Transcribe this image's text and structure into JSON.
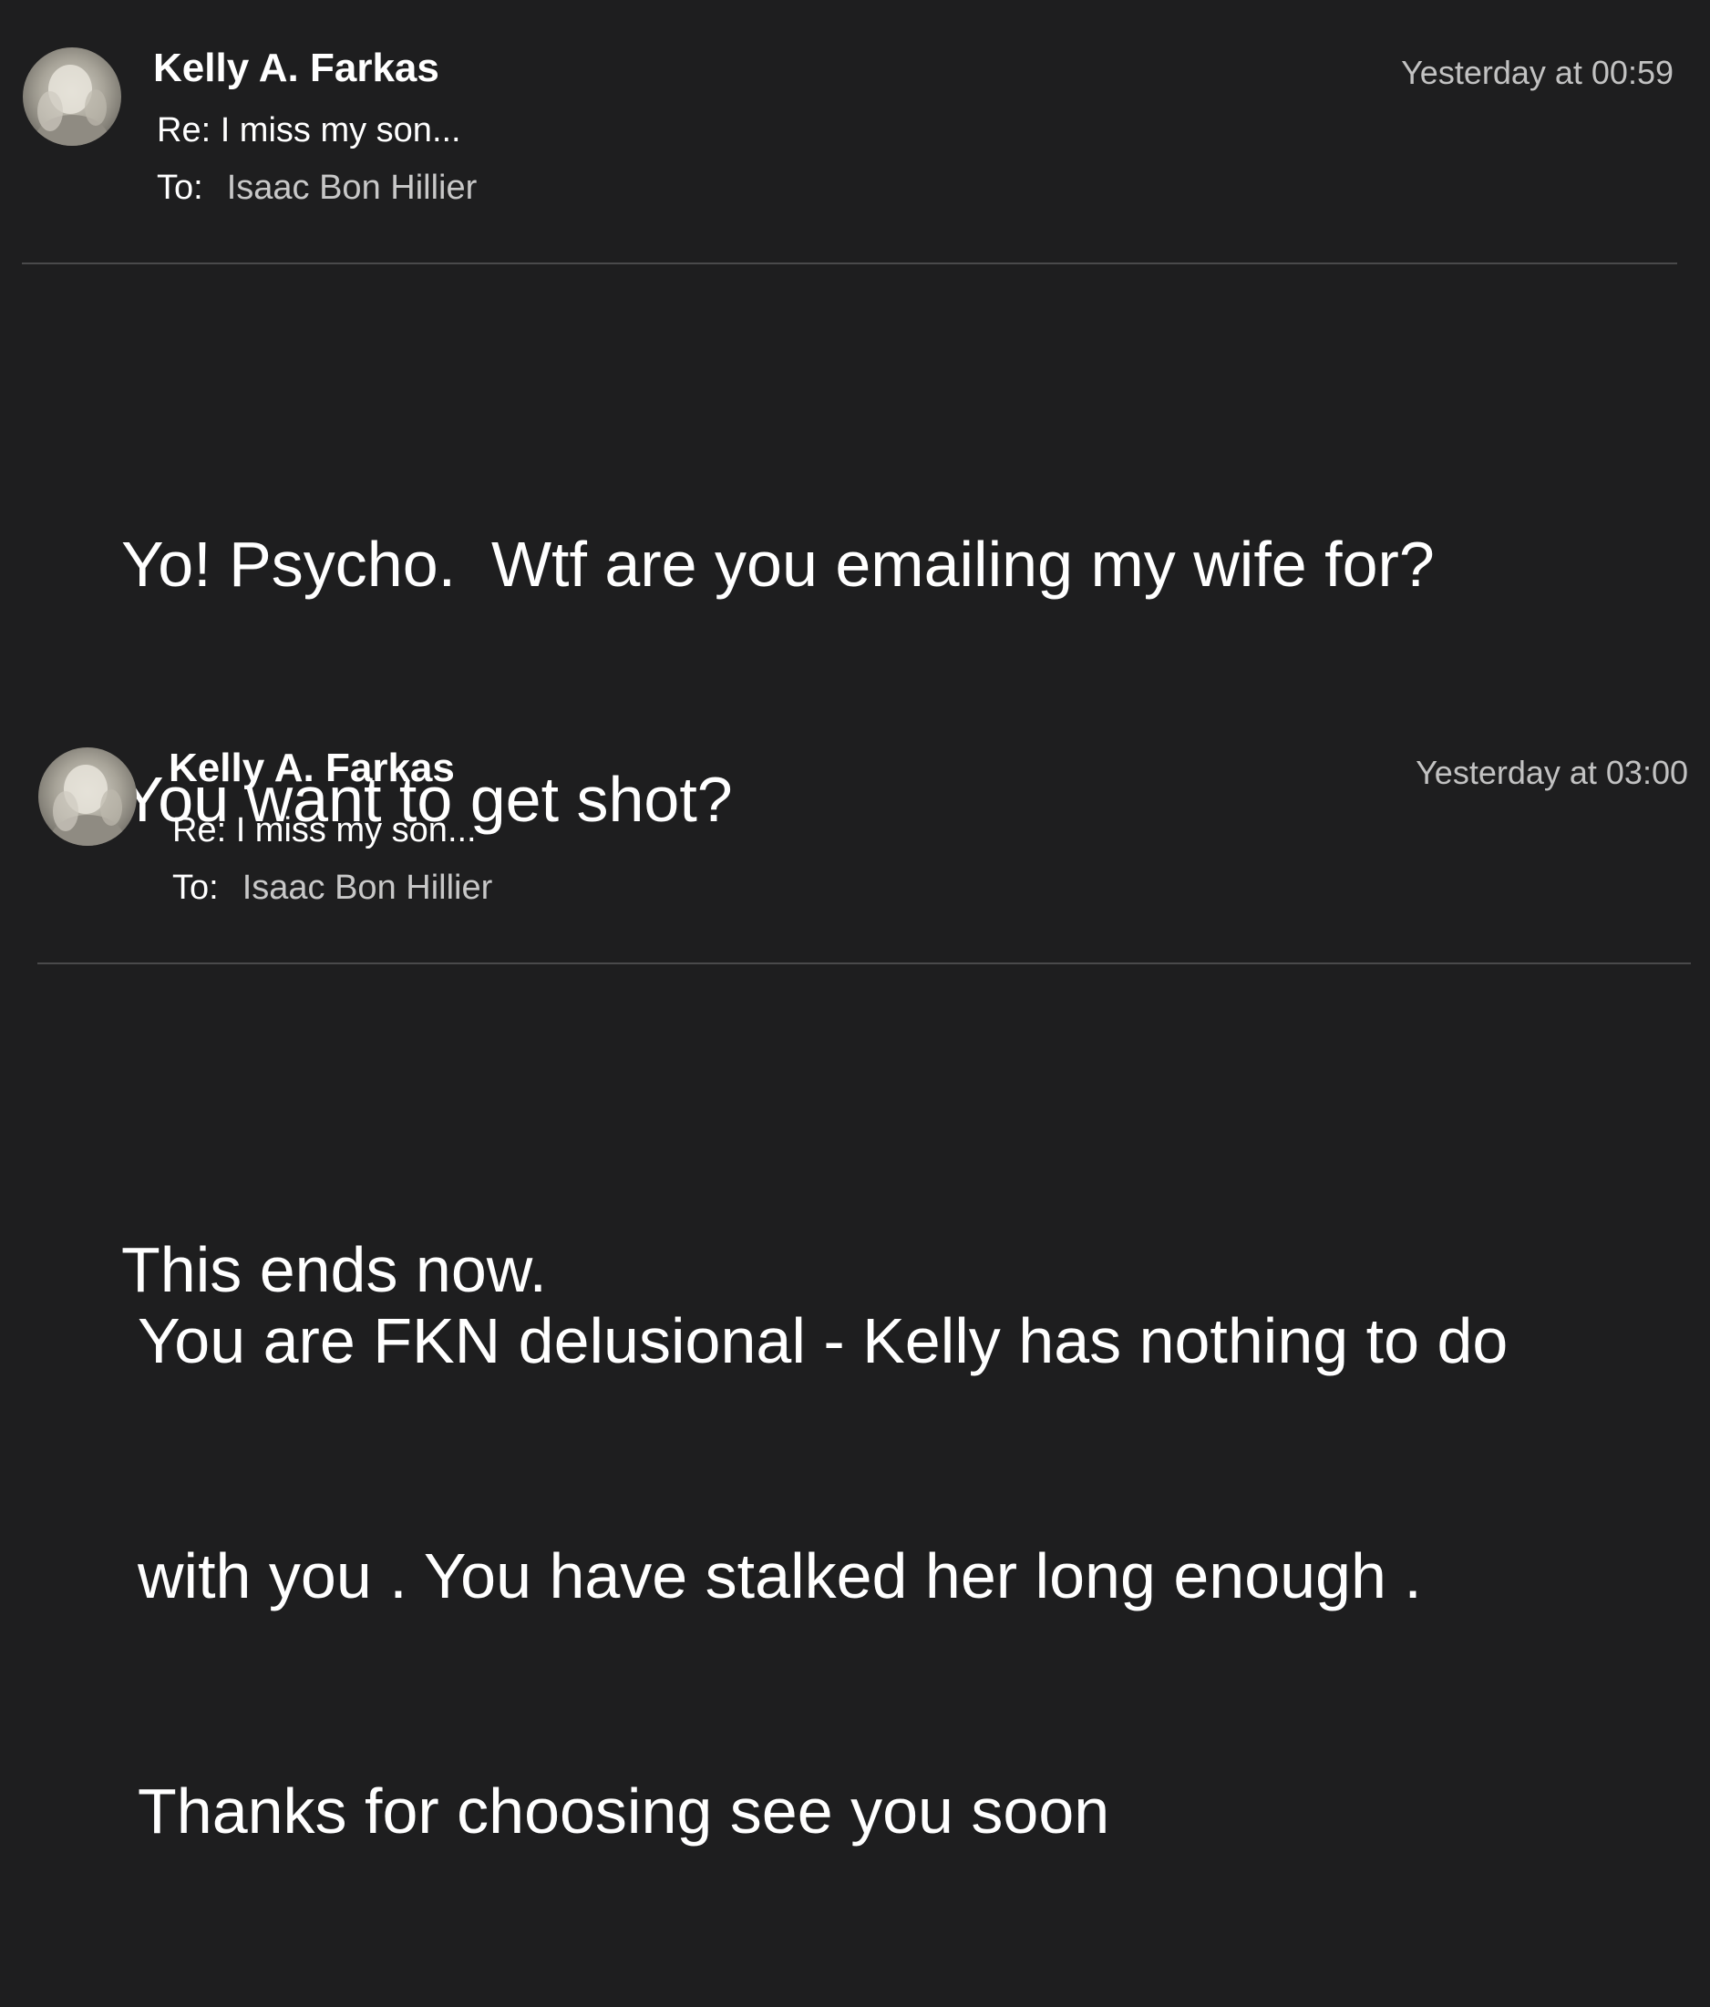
{
  "messages": [
    {
      "sender": "Kelly A. Farkas",
      "subject": "Re: I miss my son...",
      "to_label": "To:",
      "to_name": "Isaac Bon Hillier",
      "timestamp": "Yesterday at 00:59",
      "body_lines": [
        "Yo! Psycho.  Wtf are you emailing my wife for?",
        "You want to get shot?",
        "",
        "This ends now."
      ]
    },
    {
      "sender": "Kelly A. Farkas",
      "subject": "Re: I miss my son...",
      "to_label": "To:",
      "to_name": "Isaac Bon Hillier",
      "timestamp": "Yesterday at 03:00",
      "body_lines": [
        "You are FKN delusional - Kelly has nothing to do",
        "with you . You have stalked her long enough .",
        "Thanks for choosing see you soon"
      ]
    }
  ],
  "colors": {
    "background": "#1e1e1f",
    "text": "#ffffff",
    "muted": "#c2c2c2",
    "divider": "#4a4a4b"
  }
}
